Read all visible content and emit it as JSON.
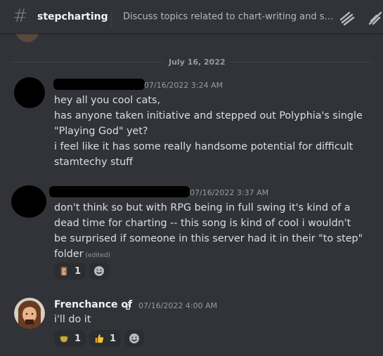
{
  "header": {
    "hash": "#",
    "channel_name": "stepcharting",
    "topic": "Discuss topics related to chart-writing and simfi..."
  },
  "date_separator": "July 16, 2022",
  "messages": [
    {
      "timestamp": "07/16/2022 3:24 AM",
      "lines": [
        "hey all you cool cats,",
        "has anyone taken initiative and stepped out Polyphia's single",
        "\"Playing God\" yet?",
        "i feel like it has some really handsome potential for difficult",
        "stamtechy stuff"
      ]
    },
    {
      "timestamp": "07/16/2022 3:37 AM",
      "lines": [
        "don't think so but with RPG being in full swing it's kind of a",
        "dead time for charting -- this song is kind of cool i wouldn't",
        "be surprised if someone in this server had it in their \"to step\"",
        "folder"
      ],
      "edited": "(edited)",
      "reactions": [
        {
          "emoji": "door-emoji",
          "count": "1"
        }
      ]
    },
    {
      "username": "Frenchance of",
      "badge": "อ",
      "timestamp": "07/16/2022 4:00 AM",
      "lines": [
        "i'll do it"
      ],
      "reactions": [
        {
          "emoji": "pot-emoji",
          "count": "1"
        },
        {
          "emoji": "thumbs-up-emoji",
          "count": "1"
        }
      ]
    }
  ],
  "colors": {
    "background": "#313338",
    "text": "#dbdee1",
    "muted": "#949ba4",
    "reaction_bg": "#2b2d31"
  }
}
